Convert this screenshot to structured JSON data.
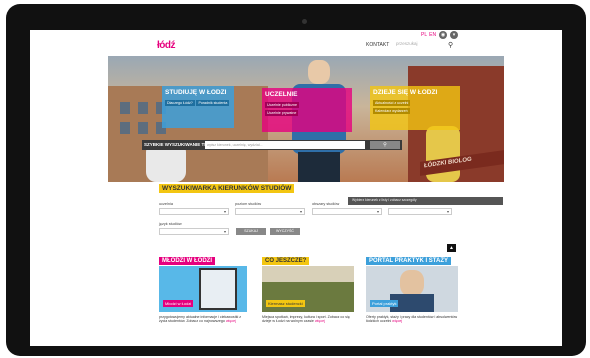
{
  "header": {
    "logo": "łódź",
    "languages": [
      "PL",
      "EN"
    ],
    "contact_label": "KONTAKT",
    "search_placeholder": "przeszukaj"
  },
  "hero": {
    "panels": [
      {
        "title": "STUDIUJĘ W ŁODZI",
        "chips": [
          "Dlaczego Łódź?",
          "Poradnik studenta"
        ]
      },
      {
        "title": "UCZELNIE",
        "chips": [
          "Uczelnie publiczne",
          "Uczelnie prywatne"
        ]
      },
      {
        "title": "DZIEJE SIĘ W ŁODZI",
        "chips": [
          "Aktualności z uczelni",
          "Kalendarz wydarzeń"
        ]
      }
    ],
    "quick_search": {
      "label": "SZYBKIE WYSZUKIWANIE TEMATU:",
      "placeholder": "wpisz kierunek, uczelnię, wydział...",
      "button_icon": "search-icon"
    },
    "banner_text": "ŁÓDZKI BIOLOG"
  },
  "finder": {
    "title": "WYSZUKIWARKA KIERUNKÓW STUDIÓW",
    "fields": [
      {
        "label": "uczelnia"
      },
      {
        "label": "poziom studiów"
      },
      {
        "label": "obszary studiów"
      },
      {
        "label": "język studiów"
      }
    ],
    "darkbar_text": "Wybierz kierunek z listy i zobacz szczegóły",
    "search_button": "SZUKAJ",
    "clear_button": "WYCZYŚĆ"
  },
  "cards": [
    {
      "title": "MŁODZI W ŁODZI",
      "img_caption": "Młodzi w Łodzi",
      "text": "przygotowujemy aktualne informacje i ciekawostki z życia studentów. Zobacz co najnowszego",
      "link": "więcej"
    },
    {
      "title": "CO JESZCZE?",
      "img_caption": "Kiermasz studencki",
      "text": "Miejsca spotkań, imprezy, kultura i sport. Zobacz co się dzieje w Łodzi na wolnym czasie",
      "link": "więcej"
    },
    {
      "title": "PORTAL PRAKTYK I STAŻY",
      "img_caption": "Portal praktyk",
      "text": "Oferty praktyk, staży i pracy dla studentów i absolwentów łódzkich uczelni",
      "link": "więcej"
    }
  ],
  "colors": {
    "pink": "#e6007e",
    "blue": "#3da0db",
    "yellow": "#f3c612",
    "dark": "#3a3a3a"
  }
}
